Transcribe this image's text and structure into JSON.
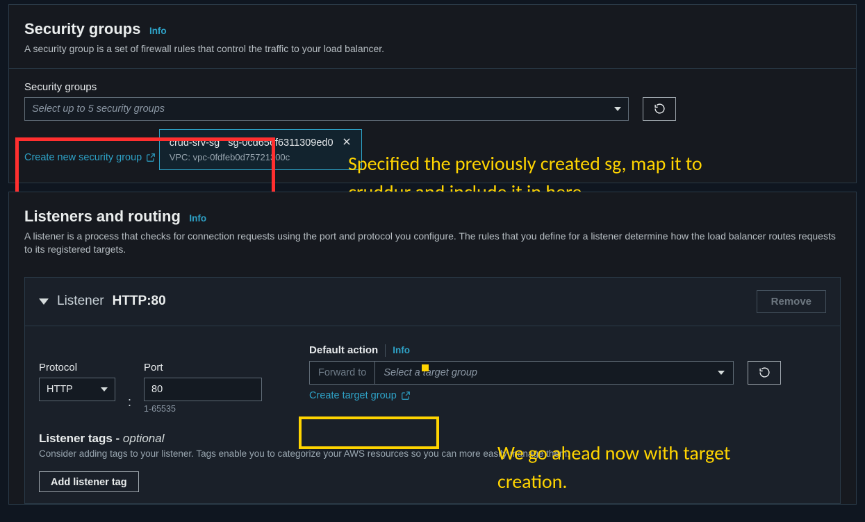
{
  "securityGroups": {
    "title": "Security groups",
    "info": "Info",
    "desc": "A security group is a set of firewall rules that control the traffic to your load balancer.",
    "fieldLabel": "Security groups",
    "placeholder": "Select up to 5 security groups",
    "createLink": "Create new security group",
    "selected": {
      "name": "crud-srv-sg",
      "id": "sg-0cd656f6311309ed0",
      "vpc": "VPC: vpc-0fdfeb0d75721300c"
    }
  },
  "listeners": {
    "title": "Listeners and routing",
    "info": "Info",
    "desc": "A listener is a process that checks for connection requests using the port and protocol you configure. The rules that you define for a listener determine how the load balancer routes requests to its registered targets.",
    "listenerWord": "Listener",
    "listenerProto": "HTTP:80",
    "removeLabel": "Remove",
    "protocolLabel": "Protocol",
    "protocolValue": "HTTP",
    "portLabel": "Port",
    "portValue": "80",
    "portRange": "1-65535",
    "defaultActionLabel": "Default action",
    "defaultActionInfo": "Info",
    "forwardTo": "Forward to",
    "tgPlaceholder": "Select a target group",
    "createTgLink": "Create target group",
    "tagsTitle": "Listener tags - ",
    "tagsOpt": "optional",
    "tagsDesc": "Consider adding tags to your listener. Tags enable you to categorize your AWS resources so you can more easily manage them.",
    "addTagLabel": "Add listener tag"
  },
  "annotations": {
    "sg": "Specified the previously created sg, map it to cruddur and include it in here.",
    "tg": "We go ahead now with target creation."
  }
}
